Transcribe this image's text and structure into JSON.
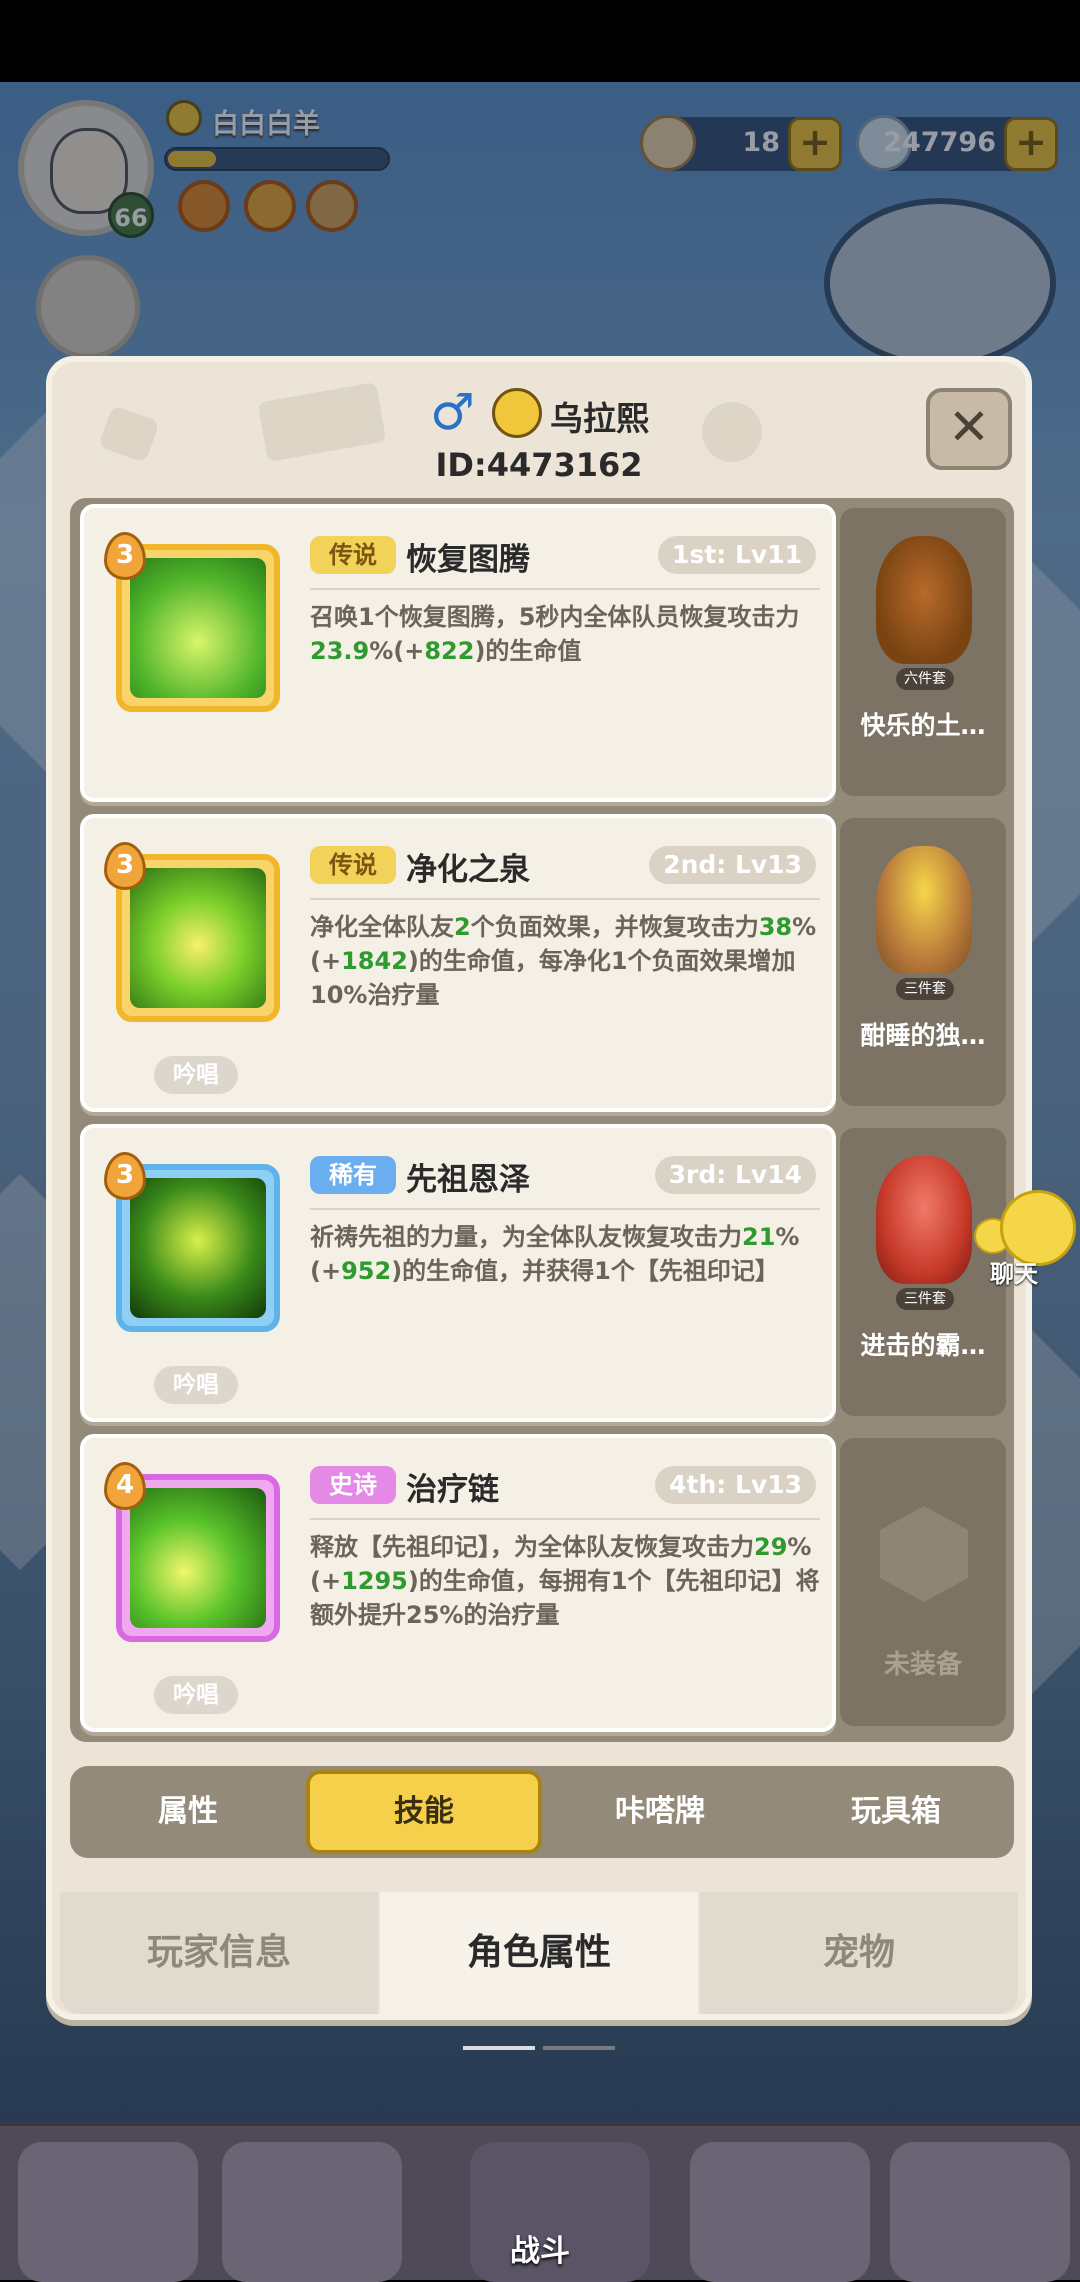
{
  "hud": {
    "player_name": "白白白羊",
    "player_level": "66",
    "xp_fraction": 0.22,
    "resources": [
      {
        "icon": "shell-icon",
        "value": "18"
      },
      {
        "icon": "pearl-icon",
        "value": "247796"
      }
    ]
  },
  "panel": {
    "character_name": "乌拉熙",
    "character_id": "ID:4473162",
    "close_icon": "close-icon",
    "skills": [
      {
        "level": "3",
        "rarity": "传说",
        "rarity_color": "#f3d25a",
        "name": "恢复图腾",
        "order": "1st: Lv11",
        "desc_parts": [
          "召唤1个恢复图腾，5秒内全体队员恢复攻击力",
          "23.9",
          "%(+",
          "822",
          ")的生命值"
        ],
        "chant": "",
        "toy": {
          "name": "快乐的土…",
          "set": "六件套"
        }
      },
      {
        "level": "3",
        "rarity": "传说",
        "rarity_color": "#f3d25a",
        "name": "净化之泉",
        "order": "2nd: Lv13",
        "desc_parts": [
          "净化全体队友",
          "2",
          "个负面效果，并恢复攻击力",
          "38",
          "%(+",
          "1842",
          ")的生命值，每净化1个负面效果增加10%治疗量"
        ],
        "chant": "吟唱",
        "toy": {
          "name": "酣睡的独…",
          "set": "三件套"
        }
      },
      {
        "level": "3",
        "rarity": "稀有",
        "rarity_color": "#6aaef0",
        "name": "先祖恩泽",
        "order": "3rd: Lv14",
        "desc_parts": [
          "祈祷先祖的力量，为全体队友恢复攻击力",
          "21",
          "%(+",
          "952",
          ")的生命值，并获得1个【先祖印记】"
        ],
        "chant": "吟唱",
        "toy": {
          "name": "进击的霸…",
          "set": "三件套"
        }
      },
      {
        "level": "4",
        "rarity": "史诗",
        "rarity_color": "#e48ae6",
        "name": "治疗链",
        "order": "4th: Lv13",
        "desc_parts": [
          "释放【先祖印记】，为全体队友恢复攻击力",
          "29",
          "%(+",
          "1295",
          ")的生命值，每拥有1个【先祖印记】将额外提升25%的治疗量"
        ],
        "chant": "吟唱",
        "toy": {
          "name": "未装备",
          "set": ""
        }
      }
    ],
    "subtabs": [
      "属性",
      "技能",
      "咔嗒牌",
      "玩具箱"
    ],
    "active_subtab": "技能",
    "maintabs": [
      "玩家信息",
      "角色属性",
      "宠物"
    ],
    "active_maintab": "角色属性"
  },
  "chat_label": "聊天",
  "bottom_nav": {
    "fight_label": "战斗"
  }
}
